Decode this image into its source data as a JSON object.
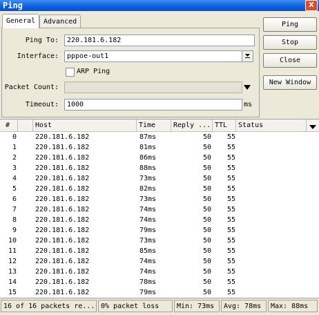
{
  "window": {
    "title": "Ping",
    "close_glyph": "X"
  },
  "tabs": [
    {
      "label": "General"
    },
    {
      "label": "Advanced"
    }
  ],
  "form": {
    "ping_to_label": "Ping To:",
    "ping_to_value": "220.181.6.182",
    "interface_label": "Interface:",
    "interface_value": "pppoe-out1",
    "arp_ping_label": "ARP Ping",
    "packet_count_label": "Packet Count:",
    "packet_count_value": "",
    "timeout_label": "Timeout:",
    "timeout_value": "1000",
    "timeout_unit": "ms"
  },
  "buttons": {
    "ping": "Ping",
    "stop": "Stop",
    "close": "Close",
    "new_window": "New Window"
  },
  "table": {
    "columns": [
      "#",
      "Host",
      "Time",
      "Reply ...",
      "TTL",
      "Status"
    ],
    "rows": [
      {
        "n": "0",
        "host": "220.181.6.182",
        "time": "87ms",
        "reply": "50",
        "ttl": "55",
        "status": ""
      },
      {
        "n": "1",
        "host": "220.181.6.182",
        "time": "81ms",
        "reply": "50",
        "ttl": "55",
        "status": ""
      },
      {
        "n": "2",
        "host": "220.181.6.182",
        "time": "86ms",
        "reply": "50",
        "ttl": "55",
        "status": ""
      },
      {
        "n": "3",
        "host": "220.181.6.182",
        "time": "88ms",
        "reply": "50",
        "ttl": "55",
        "status": ""
      },
      {
        "n": "4",
        "host": "220.181.6.182",
        "time": "73ms",
        "reply": "50",
        "ttl": "55",
        "status": ""
      },
      {
        "n": "5",
        "host": "220.181.6.182",
        "time": "82ms",
        "reply": "50",
        "ttl": "55",
        "status": ""
      },
      {
        "n": "6",
        "host": "220.181.6.182",
        "time": "73ms",
        "reply": "50",
        "ttl": "55",
        "status": ""
      },
      {
        "n": "7",
        "host": "220.181.6.182",
        "time": "74ms",
        "reply": "50",
        "ttl": "55",
        "status": ""
      },
      {
        "n": "8",
        "host": "220.181.6.182",
        "time": "74ms",
        "reply": "50",
        "ttl": "55",
        "status": ""
      },
      {
        "n": "9",
        "host": "220.181.6.182",
        "time": "79ms",
        "reply": "50",
        "ttl": "55",
        "status": ""
      },
      {
        "n": "10",
        "host": "220.181.6.182",
        "time": "73ms",
        "reply": "50",
        "ttl": "55",
        "status": ""
      },
      {
        "n": "11",
        "host": "220.181.6.182",
        "time": "85ms",
        "reply": "50",
        "ttl": "55",
        "status": ""
      },
      {
        "n": "12",
        "host": "220.181.6.182",
        "time": "74ms",
        "reply": "50",
        "ttl": "55",
        "status": ""
      },
      {
        "n": "13",
        "host": "220.181.6.182",
        "time": "74ms",
        "reply": "50",
        "ttl": "55",
        "status": ""
      },
      {
        "n": "14",
        "host": "220.181.6.182",
        "time": "78ms",
        "reply": "50",
        "ttl": "55",
        "status": ""
      },
      {
        "n": "15",
        "host": "220.181.6.182",
        "time": "79ms",
        "reply": "50",
        "ttl": "55",
        "status": ""
      }
    ]
  },
  "statusbar": {
    "packets": "16 of 16 packets re...",
    "loss": "0% packet loss",
    "min": "Min: 73ms",
    "avg": "Avg: 78ms",
    "max": "Max: 88ms"
  },
  "icons": {
    "dropdown": "dropdown-arrow-icon",
    "column_menu": "column-menu-icon",
    "close": "close-icon"
  },
  "colors": {
    "titlebar": "#0a5fe0",
    "window_bg": "#ece9d8",
    "close_button": "#e04a2a"
  }
}
